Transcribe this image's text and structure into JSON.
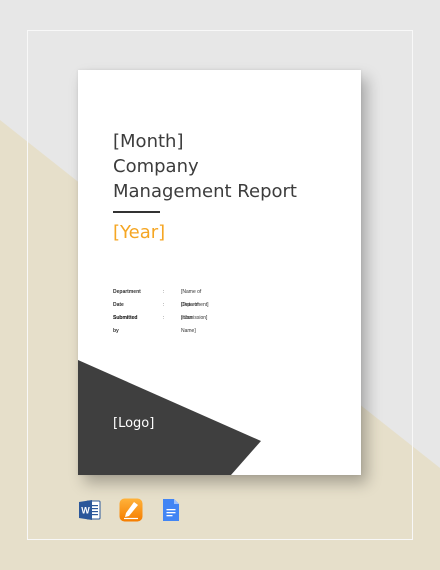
{
  "colors": {
    "background_gray": "#e7e7e7",
    "background_beige": "#e6dfca",
    "dark_band": "#3f3f3f",
    "accent": "#f5a623",
    "text": "#3c3c3c"
  },
  "document": {
    "title_lines": [
      "[Month]",
      "Company",
      "Management Report"
    ],
    "year": "[Year]",
    "details": [
      {
        "label": "Department",
        "separator": ":",
        "value": "[Name of Department]"
      },
      {
        "label": "Date Submitted",
        "separator": ":",
        "value": "[Date of submission]"
      },
      {
        "label": "Submitted by",
        "separator": ":",
        "value": "[Your Name]"
      }
    ],
    "logo": "[Logo]"
  },
  "apps": [
    {
      "icon": "microsoft-word-icon"
    },
    {
      "icon": "apple-pages-icon"
    },
    {
      "icon": "google-docs-icon"
    }
  ]
}
